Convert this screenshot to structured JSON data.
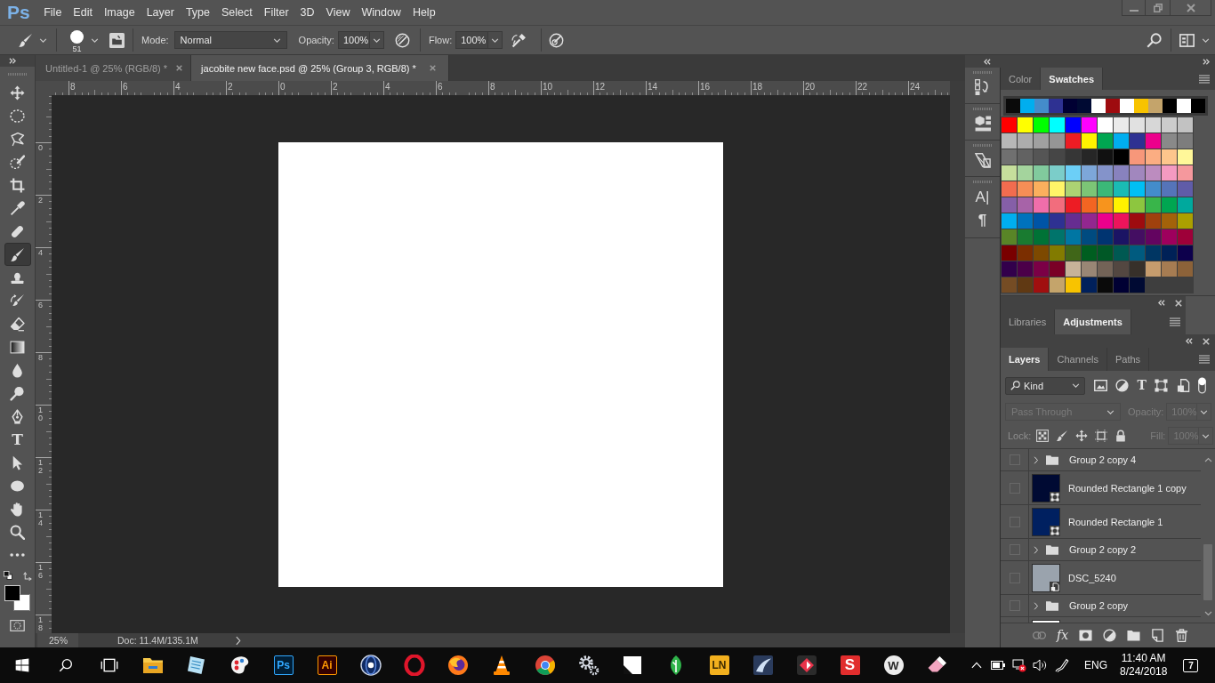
{
  "app": {
    "logo": "Ps"
  },
  "menu": [
    "File",
    "Edit",
    "Image",
    "Layer",
    "Type",
    "Select",
    "Filter",
    "3D",
    "View",
    "Window",
    "Help"
  ],
  "options_bar": {
    "brush_size": "51",
    "mode_label": "Mode:",
    "mode": "Normal",
    "opacity_label": "Opacity:",
    "opacity": "100%",
    "flow_label": "Flow:",
    "flow": "100%"
  },
  "tools": [
    {
      "kind": "move",
      "selected": false
    },
    {
      "kind": "marquee",
      "selected": false
    },
    {
      "kind": "lasso",
      "selected": false
    },
    {
      "kind": "quick-select",
      "selected": false
    },
    {
      "kind": "crop",
      "selected": false
    },
    {
      "kind": "eyedropper",
      "selected": false
    },
    {
      "kind": "healing",
      "selected": false
    },
    {
      "kind": "brush",
      "selected": true
    },
    {
      "kind": "stamp",
      "selected": false
    },
    {
      "kind": "history-brush",
      "selected": false
    },
    {
      "kind": "eraser",
      "selected": false
    },
    {
      "kind": "gradient",
      "selected": false
    },
    {
      "kind": "blur",
      "selected": false
    },
    {
      "kind": "dodge",
      "selected": false
    },
    {
      "kind": "pen",
      "selected": false
    },
    {
      "kind": "type",
      "glyph": "T",
      "selected": false
    },
    {
      "kind": "path-select",
      "selected": false
    },
    {
      "kind": "ellipse",
      "selected": false
    },
    {
      "kind": "hand",
      "selected": false
    },
    {
      "kind": "zoom",
      "selected": false
    },
    {
      "kind": "more",
      "selected": false
    }
  ],
  "color_swatches": [
    {
      "kind": "background",
      "color": "#ffffff"
    },
    {
      "kind": "foreground",
      "color": "#000000"
    }
  ],
  "documents": [
    {
      "title": "Untitled-1 @ 25% (RGB/8) *",
      "selected": false
    },
    {
      "title": "jacobite new face.psd @ 25% (Group 3, RGB/8) *",
      "selected": true
    }
  ],
  "rulers": {
    "horizontal": [
      "8",
      "6",
      "4",
      "2",
      "0",
      "2",
      "4",
      "6",
      "8",
      "10",
      "12",
      "14",
      "16",
      "18",
      "20",
      "22",
      "24"
    ],
    "vertical": [
      "0",
      "2",
      "4",
      "6",
      "8",
      "10",
      "12",
      "14",
      "16",
      "18"
    ]
  },
  "status_bar": {
    "zoom": "25%",
    "document_size": "Doc: 11.4M/135.1M"
  },
  "dock": [
    {
      "items": [
        {
          "kind": "history"
        }
      ]
    },
    {
      "items": [
        {
          "kind": "cube"
        }
      ]
    },
    {
      "items": [
        {
          "kind": "properties"
        }
      ]
    },
    {
      "items": [
        {
          "kind": "character",
          "glyph": "A|"
        },
        {
          "kind": "paragraph",
          "glyph": "¶"
        }
      ]
    }
  ],
  "color_panel": {
    "tabs": [
      {
        "label": "Color",
        "selected": false
      },
      {
        "label": "Swatches",
        "selected": true
      }
    ],
    "recent": [
      {
        "color": "#0a0a0a"
      },
      {
        "color": "#00aeef"
      },
      {
        "color": "#448ccb"
      },
      {
        "color": "#2e3192"
      },
      {
        "color": "#000033"
      },
      {
        "color": "#000a33"
      },
      {
        "color": "#ffffff"
      },
      {
        "color": "#9e0b0f"
      },
      {
        "color": "#ffffff"
      },
      {
        "color": "#f8c300"
      },
      {
        "color": "#c4a46b"
      },
      {
        "color": "#000000"
      },
      {
        "color": "#ffffff"
      },
      {
        "color": "#000000"
      }
    ],
    "swatches": [
      {
        "color": "#ff0000"
      },
      {
        "color": "#ffff00"
      },
      {
        "color": "#00ff00"
      },
      {
        "color": "#00ffff"
      },
      {
        "color": "#0000ff"
      },
      {
        "color": "#ff00ff"
      },
      {
        "color": "#ffffff"
      },
      {
        "color": "#ebebeb"
      },
      {
        "color": "#e1e1e1"
      },
      {
        "color": "#d7d7d7"
      },
      {
        "color": "#cccccc"
      },
      {
        "color": "#c2c2c2"
      },
      {
        "color": "#b7b7b7"
      },
      {
        "color": "#acacac"
      },
      {
        "color": "#a0a0a0"
      },
      {
        "color": "#959595"
      },
      {
        "color": "#ed1c24"
      },
      {
        "color": "#fff200"
      },
      {
        "color": "#00a651"
      },
      {
        "color": "#00aeef"
      },
      {
        "color": "#2e3192"
      },
      {
        "color": "#ec008c"
      },
      {
        "color": "#898989"
      },
      {
        "color": "#7d7d7d"
      },
      {
        "color": "#707070"
      },
      {
        "color": "#626262"
      },
      {
        "color": "#555555"
      },
      {
        "color": "#464646"
      },
      {
        "color": "#363636"
      },
      {
        "color": "#262626"
      },
      {
        "color": "#111111"
      },
      {
        "color": "#000000"
      },
      {
        "color": "#f7977a"
      },
      {
        "color": "#fbad82"
      },
      {
        "color": "#fdc68c"
      },
      {
        "color": "#fff799"
      },
      {
        "color": "#c6df9c"
      },
      {
        "color": "#a4d49d"
      },
      {
        "color": "#81ca9d"
      },
      {
        "color": "#7bcdc9"
      },
      {
        "color": "#6ccff7"
      },
      {
        "color": "#7da7d9"
      },
      {
        "color": "#8493ca"
      },
      {
        "color": "#8882be"
      },
      {
        "color": "#a187be"
      },
      {
        "color": "#bc8cbf"
      },
      {
        "color": "#f49ac1"
      },
      {
        "color": "#f5989d"
      },
      {
        "color": "#f26c4f"
      },
      {
        "color": "#f68e56"
      },
      {
        "color": "#fbaf5d"
      },
      {
        "color": "#fff568"
      },
      {
        "color": "#acd373"
      },
      {
        "color": "#7cc576"
      },
      {
        "color": "#3bb878"
      },
      {
        "color": "#1abbb4"
      },
      {
        "color": "#00bff3"
      },
      {
        "color": "#438ccb"
      },
      {
        "color": "#5574b9"
      },
      {
        "color": "#605ca8"
      },
      {
        "color": "#855fa8"
      },
      {
        "color": "#a763a8"
      },
      {
        "color": "#f06eaa"
      },
      {
        "color": "#f26d7d"
      },
      {
        "color": "#ed1c24"
      },
      {
        "color": "#f26522"
      },
      {
        "color": "#f7941d"
      },
      {
        "color": "#fff200"
      },
      {
        "color": "#8dc63f"
      },
      {
        "color": "#39b54a"
      },
      {
        "color": "#00a651"
      },
      {
        "color": "#00a99d"
      },
      {
        "color": "#00aeef"
      },
      {
        "color": "#0072bc"
      },
      {
        "color": "#0054a6"
      },
      {
        "color": "#2e3192"
      },
      {
        "color": "#662d91"
      },
      {
        "color": "#92278f"
      },
      {
        "color": "#ec008c"
      },
      {
        "color": "#ed145b"
      },
      {
        "color": "#9e0b0f"
      },
      {
        "color": "#a0410d"
      },
      {
        "color": "#a3620a"
      },
      {
        "color": "#aba000"
      },
      {
        "color": "#598527"
      },
      {
        "color": "#197b30"
      },
      {
        "color": "#007236"
      },
      {
        "color": "#00746b"
      },
      {
        "color": "#0076a3"
      },
      {
        "color": "#004b80"
      },
      {
        "color": "#003471"
      },
      {
        "color": "#1b1464"
      },
      {
        "color": "#440e62"
      },
      {
        "color": "#630460"
      },
      {
        "color": "#9e005d"
      },
      {
        "color": "#9e0039"
      },
      {
        "color": "#790000"
      },
      {
        "color": "#7b2e00"
      },
      {
        "color": "#7d4900"
      },
      {
        "color": "#827b00"
      },
      {
        "color": "#406618"
      },
      {
        "color": "#005e20"
      },
      {
        "color": "#005826"
      },
      {
        "color": "#005952"
      },
      {
        "color": "#005b7f"
      },
      {
        "color": "#003663"
      },
      {
        "color": "#002157"
      },
      {
        "color": "#0d004c"
      },
      {
        "color": "#32004b"
      },
      {
        "color": "#4b0049"
      },
      {
        "color": "#7b0046"
      },
      {
        "color": "#7a0026"
      },
      {
        "color": "#c7b299"
      },
      {
        "color": "#998675"
      },
      {
        "color": "#736357"
      },
      {
        "color": "#534741"
      },
      {
        "color": "#37302a"
      },
      {
        "color": "#c69c6d"
      },
      {
        "color": "#a67c52"
      },
      {
        "color": "#8c6239"
      },
      {
        "color": "#754c24"
      },
      {
        "color": "#603913"
      },
      {
        "color": "#a00f0f"
      },
      {
        "color": "#c4a46b"
      },
      {
        "color": "#f8c300"
      },
      {
        "color": "#00205b"
      },
      {
        "color": "#0a0a0a"
      },
      {
        "color": "#000033"
      },
      {
        "color": "#000a33"
      }
    ]
  },
  "libraries_panel": {
    "tabs": [
      {
        "label": "Libraries",
        "selected": false
      },
      {
        "label": "Adjustments",
        "selected": true
      }
    ]
  },
  "layers_panel": {
    "tabs": [
      {
        "label": "Layers",
        "selected": true
      },
      {
        "label": "Channels",
        "selected": false
      },
      {
        "label": "Paths",
        "selected": false
      }
    ],
    "filter": {
      "label": "Kind",
      "type_glyph": "T",
      "on": true
    },
    "blend_mode": {
      "value": "Pass Through",
      "disabled": true
    },
    "opacity": {
      "label": "Opacity:",
      "value": "100%",
      "disabled": true
    },
    "lock": {
      "label": "Lock:"
    },
    "fill": {
      "label": "Fill:",
      "value": "100%",
      "disabled": true
    },
    "layers": [
      {
        "kind": "group",
        "name": "Group 2 copy 4",
        "visible": false,
        "expanded": false
      },
      {
        "kind": "shape",
        "name": "Rounded Rectangle 1 copy",
        "color": "#000a33",
        "visible": false
      },
      {
        "kind": "shape",
        "name": "Rounded Rectangle 1",
        "color": "#002060",
        "visible": false
      },
      {
        "kind": "group",
        "name": "Group 2 copy 2",
        "visible": false,
        "expanded": false
      },
      {
        "kind": "smart",
        "name": "DSC_5240",
        "visible": false
      },
      {
        "kind": "group",
        "name": "Group 2 copy",
        "visible": false,
        "expanded": false
      },
      {
        "kind": "pixel",
        "color": "#ffffff"
      }
    ],
    "footer": {
      "effects": "fx"
    }
  },
  "taskbar": {
    "apps": [
      {
        "kind": "start"
      },
      {
        "kind": "search"
      },
      {
        "kind": "task-view"
      },
      {
        "kind": "folder"
      },
      {
        "kind": "sheet"
      },
      {
        "kind": "palette"
      },
      {
        "kind": "ps",
        "label": "Ps"
      },
      {
        "kind": "ai",
        "label": "Ai"
      },
      {
        "kind": "sphere"
      },
      {
        "kind": "ring"
      },
      {
        "kind": "globe"
      },
      {
        "kind": "cone"
      },
      {
        "kind": "segmented"
      },
      {
        "kind": "gears"
      },
      {
        "kind": "note"
      },
      {
        "kind": "leaf"
      },
      {
        "kind": "ln",
        "label": "LN"
      },
      {
        "kind": "sail"
      },
      {
        "kind": "diamond"
      },
      {
        "kind": "s",
        "label": "S"
      },
      {
        "kind": "w",
        "label": "W"
      },
      {
        "kind": "eraser"
      }
    ],
    "language": "ENG",
    "time": "11:40 AM",
    "date": "8/24/2018",
    "notifications": "7"
  }
}
